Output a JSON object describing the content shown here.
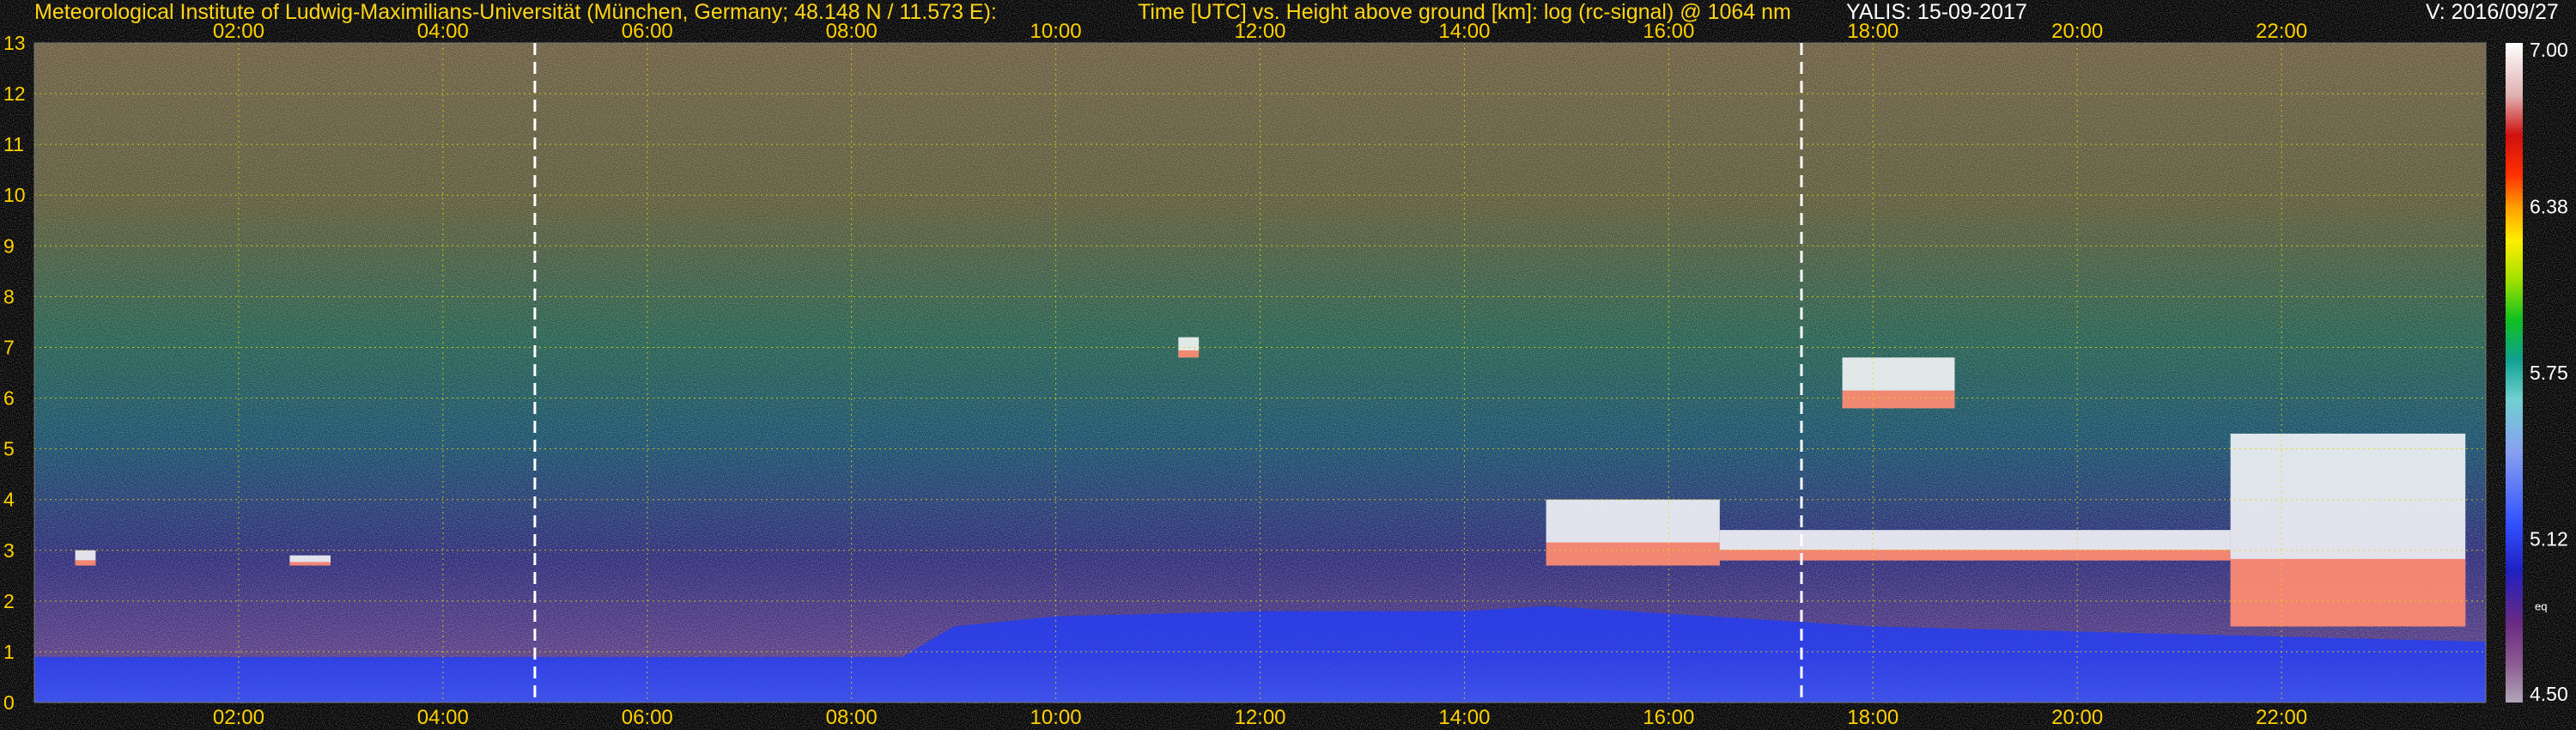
{
  "header": {
    "institute": "Meteorological Institute of Ludwig-Maximilians-Universität (München, Germany; 48.148 N / 11.573 E):",
    "plot_desc": "Time [UTC] vs. Height above ground [km]: log (rc-signal) @ 1064 nm",
    "instrument_date": "YALIS: 15-09-2017",
    "version": "V: 2016/09/27"
  },
  "colors": {
    "text_accent": "#ffd000",
    "grid": "#e8d800",
    "cloud": "#ffffff",
    "aerosol_layer": "#1e3cff"
  },
  "chart_data": {
    "type": "heatmap",
    "title": "Time [UTC] vs. Height above ground [km]: log (rc-signal) @ 1064 nm",
    "xlabel": "",
    "ylabel": "",
    "x_ticks": [
      "02:00",
      "04:00",
      "06:00",
      "08:00",
      "10:00",
      "12:00",
      "14:00",
      "16:00",
      "18:00",
      "20:00",
      "22:00"
    ],
    "x_range_hours": [
      0,
      24
    ],
    "y_ticks": [
      0,
      1,
      2,
      3,
      4,
      5,
      6,
      7,
      8,
      9,
      10,
      11,
      12,
      13
    ],
    "y_range_km": [
      0,
      13
    ],
    "colorbar": {
      "range": [
        4.5,
        7.0
      ],
      "tick_labels": [
        "7.00",
        "6.38",
        "5.75",
        "5.12",
        "4.50"
      ],
      "tick_values": [
        7.0,
        6.38,
        5.75,
        5.12,
        4.5
      ],
      "extra_label": "eq"
    },
    "grid": true,
    "markers_dashed_vertical_hours": [
      4.9,
      17.3
    ],
    "features": {
      "boundary_layer_top_km": [
        [
          0,
          0.9
        ],
        [
          8.5,
          0.9
        ],
        [
          9.0,
          1.5
        ],
        [
          10,
          1.7
        ],
        [
          12,
          1.8
        ],
        [
          14,
          1.8
        ],
        [
          14.8,
          1.9
        ],
        [
          18,
          1.5
        ],
        [
          22,
          1.3
        ],
        [
          24,
          1.2
        ]
      ],
      "cloud_layers": [
        {
          "start_h": 14.8,
          "end_h": 16.5,
          "base_km": 2.7,
          "top_km": 4.0
        },
        {
          "start_h": 16.5,
          "end_h": 21.5,
          "base_km": 2.8,
          "top_km": 3.4
        },
        {
          "start_h": 21.5,
          "end_h": 23.8,
          "base_km": 1.5,
          "top_km": 5.3
        },
        {
          "start_h": 17.7,
          "end_h": 18.8,
          "base_km": 5.8,
          "top_km": 6.8
        },
        {
          "start_h": 11.2,
          "end_h": 11.4,
          "base_km": 6.8,
          "top_km": 7.2
        },
        {
          "start_h": 0.4,
          "end_h": 0.6,
          "base_km": 2.7,
          "top_km": 3.0
        },
        {
          "start_h": 2.5,
          "end_h": 2.9,
          "base_km": 2.7,
          "top_km": 2.9
        }
      ]
    }
  }
}
